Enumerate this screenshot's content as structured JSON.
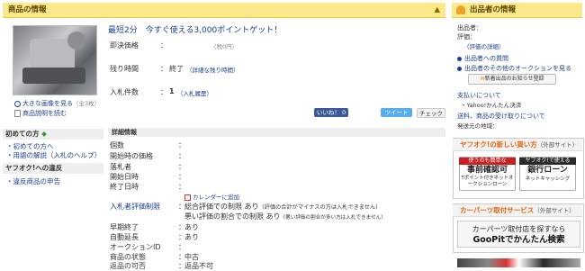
{
  "header": {
    "title": "商品の情報",
    "arrow": "▲"
  },
  "seller_header": {
    "title": "出品者の情報"
  },
  "promo": {
    "text": "最短2分　今すぐ使える3,000ポイントゲット！"
  },
  "price": {
    "label": "即決価格",
    "colon": "：",
    "value": "（税0円）"
  },
  "time": {
    "label": "残り時間",
    "colon": "：",
    "value": "終了",
    "note": "（詳細な残り時間）"
  },
  "bids": {
    "label": "入札件数",
    "colon": "：",
    "value": "1",
    "note": "（入札履歴）"
  },
  "image_links": {
    "enlarge": "大きな画像を見る",
    "count": "（全3枚）",
    "description": "商品説明を読む"
  },
  "social": {
    "like": "いいね！ 0",
    "tweet": "ツイート",
    "check": "チェック"
  },
  "sidebar": {
    "beginners_title": "初めての方",
    "beginners_links": [
      "・初めての方へ",
      "・用語の解説（入札のヘルプ）"
    ],
    "rules_title": "ヤフオク!への違反",
    "rules_links": [
      "・違反商品の申告"
    ]
  },
  "details": {
    "title": "詳細情報",
    "rows": [
      {
        "key": "個数",
        "value": ""
      },
      {
        "key": "開始時の価格",
        "value": ""
      },
      {
        "key": "落札者",
        "value": ""
      },
      {
        "key": "開始日時",
        "value": ""
      },
      {
        "key": "終了日時",
        "value": ""
      }
    ],
    "calendar": "カレンダーに追加",
    "restrictions_key": "入札者評価制限",
    "restriction1": "総合評価での制限 あり",
    "restriction1_note": "（評価の合計がマイナスの方は入札できません）",
    "restriction2": "悪い評価の割合での制限 あり",
    "restriction2_note": "（悪い評価の割合が多い方は入札できません）",
    "rows2": [
      {
        "key": "早期終了",
        "value": "あり"
      },
      {
        "key": "自動延長",
        "value": "あり"
      },
      {
        "key": "オークションID",
        "value": ""
      },
      {
        "key": "商品の状態",
        "value": "中古"
      },
      {
        "key": "返品の可否",
        "value": "返品不可"
      }
    ],
    "colon": "："
  },
  "seller": {
    "seller_label": "出品者：",
    "rating_label": "評価：",
    "rating_detail": "（評価の詳細）",
    "question": "出品者への質問",
    "other_auctions": "出品者のその他のオークションを見る",
    "notify": "新着出品のお知らせ登録",
    "payment_title": "支払いについて",
    "payment_value": "・Yahoo!かんたん決済",
    "shipping": "送料、商品の受け取りについて",
    "shipping_from": "発送元の地域："
  },
  "yafuoku_box": {
    "title_bold": "ヤフオク!の新しい買い方",
    "title_note": "（外部サイト）",
    "banner1_bar": "使うのも簡単な",
    "banner1_big": "事前確認可",
    "banner1_sub": "Tポイント付きネットオークションローン",
    "banner2_bar": "ヤフオク!で使える",
    "banner2_big": "銀行ローン",
    "banner2_sub": "ネットキャッシング"
  },
  "car_box": {
    "title_bold": "カーパーツ取付サービス",
    "title_note": "（外部サイト）",
    "line1": "カーパーツ取付店を探すなら",
    "line2": "GooPitでかんたん検索"
  },
  "colors": {
    "accent": "#fbe98a",
    "link": "#1a3f8f",
    "orange": "#e6600b"
  }
}
